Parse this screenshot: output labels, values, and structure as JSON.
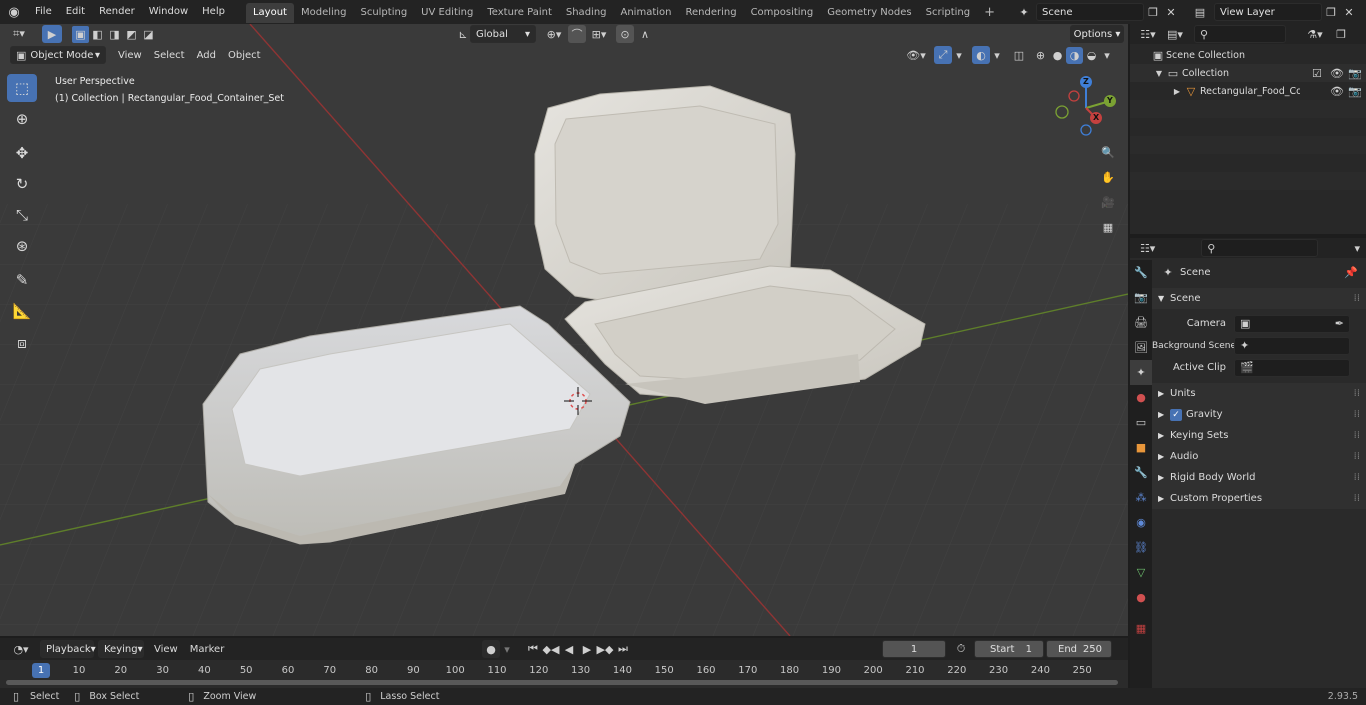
{
  "top_menu": {
    "items": [
      "File",
      "Edit",
      "Render",
      "Window",
      "Help"
    ],
    "workspaces": [
      "Layout",
      "Modeling",
      "Sculpting",
      "UV Editing",
      "Texture Paint",
      "Shading",
      "Animation",
      "Rendering",
      "Compositing",
      "Geometry Nodes",
      "Scripting"
    ],
    "active_workspace": "Layout",
    "add_tab": "+",
    "scene_name": "Scene",
    "view_layer_name": "View Layer"
  },
  "viewport_header": {
    "mode": "Object Mode",
    "menus": [
      "View",
      "Select",
      "Add",
      "Object"
    ],
    "orientation": "Global",
    "options": "Options"
  },
  "viewport": {
    "perspective": "User Perspective",
    "collection_info": "(1) Collection | Rectangular_Food_Container_Set",
    "gizmo": {
      "z": "Z",
      "y": "Y",
      "x": "X"
    }
  },
  "outliner": {
    "scene_collection": "Scene Collection",
    "collection": "Collection",
    "object": "Rectangular_Food_Conta"
  },
  "properties": {
    "context": "Scene",
    "panel": "Scene",
    "camera_label": "Camera",
    "background_scene_label": "Background Scene",
    "active_clip_label": "Active Clip",
    "sections": [
      "Units",
      "Gravity",
      "Keying Sets",
      "Audio",
      "Rigid Body World",
      "Custom Properties"
    ],
    "gravity_checked": true
  },
  "timeline": {
    "menus": [
      "Playback",
      "Keying",
      "View",
      "Marker"
    ],
    "current_frame": "1",
    "start_label": "Start",
    "start": "1",
    "end_label": "End",
    "end": "250",
    "ticks": [
      "1",
      "10",
      "20",
      "30",
      "40",
      "50",
      "60",
      "70",
      "80",
      "90",
      "100",
      "110",
      "120",
      "130",
      "140",
      "150",
      "160",
      "170",
      "180",
      "190",
      "200",
      "210",
      "220",
      "230",
      "240",
      "250"
    ]
  },
  "status_bar": {
    "select": "Select",
    "box_select": "Box Select",
    "zoom_view": "Zoom View",
    "lasso_select": "Lasso Select",
    "version": "2.93.5"
  },
  "colors": {
    "accent": "#4772b3",
    "x_axis": "#c5413f",
    "y_axis": "#7ba233",
    "z_axis": "#3f7fd8"
  }
}
